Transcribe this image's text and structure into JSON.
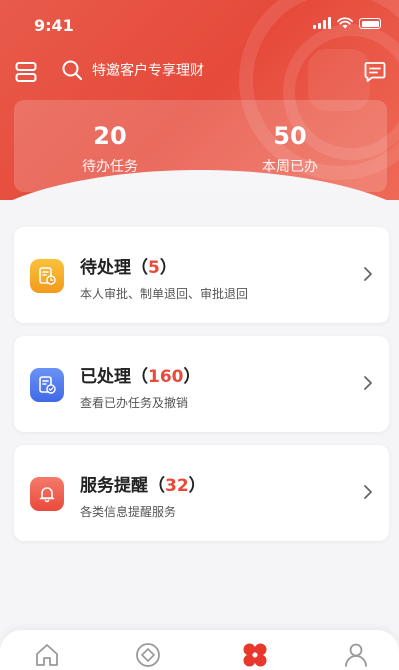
{
  "status_bar": {
    "time": "9:41"
  },
  "header": {
    "search_text": "特邀客户专享理财"
  },
  "stats": [
    {
      "value": "20",
      "label": "待办任务"
    },
    {
      "value": "50",
      "label": "本周已办"
    }
  ],
  "cards": [
    {
      "title": "待处理（",
      "count": "5",
      "close": "）",
      "subtitle": "本人审批、制单退回、审批退回",
      "icon": "document-clock-icon",
      "color": "#f5a623"
    },
    {
      "title": "已处理（",
      "count": "160",
      "close": "）",
      "subtitle": "查看已办任务及撤销",
      "icon": "document-check-icon",
      "color": "#4a7cf0"
    },
    {
      "title": "服务提醒（",
      "count": "32",
      "close": "）",
      "subtitle": "各类信息提醒服务",
      "icon": "bell-icon",
      "color": "#f05a4a"
    }
  ],
  "nav": [
    {
      "icon": "home-icon"
    },
    {
      "icon": "compass-icon"
    },
    {
      "icon": "clover-icon",
      "active_color": "#e8382c"
    },
    {
      "icon": "user-icon"
    }
  ],
  "colors": {
    "brand": "#e64a3b",
    "accent_count": "#e84a3a"
  }
}
